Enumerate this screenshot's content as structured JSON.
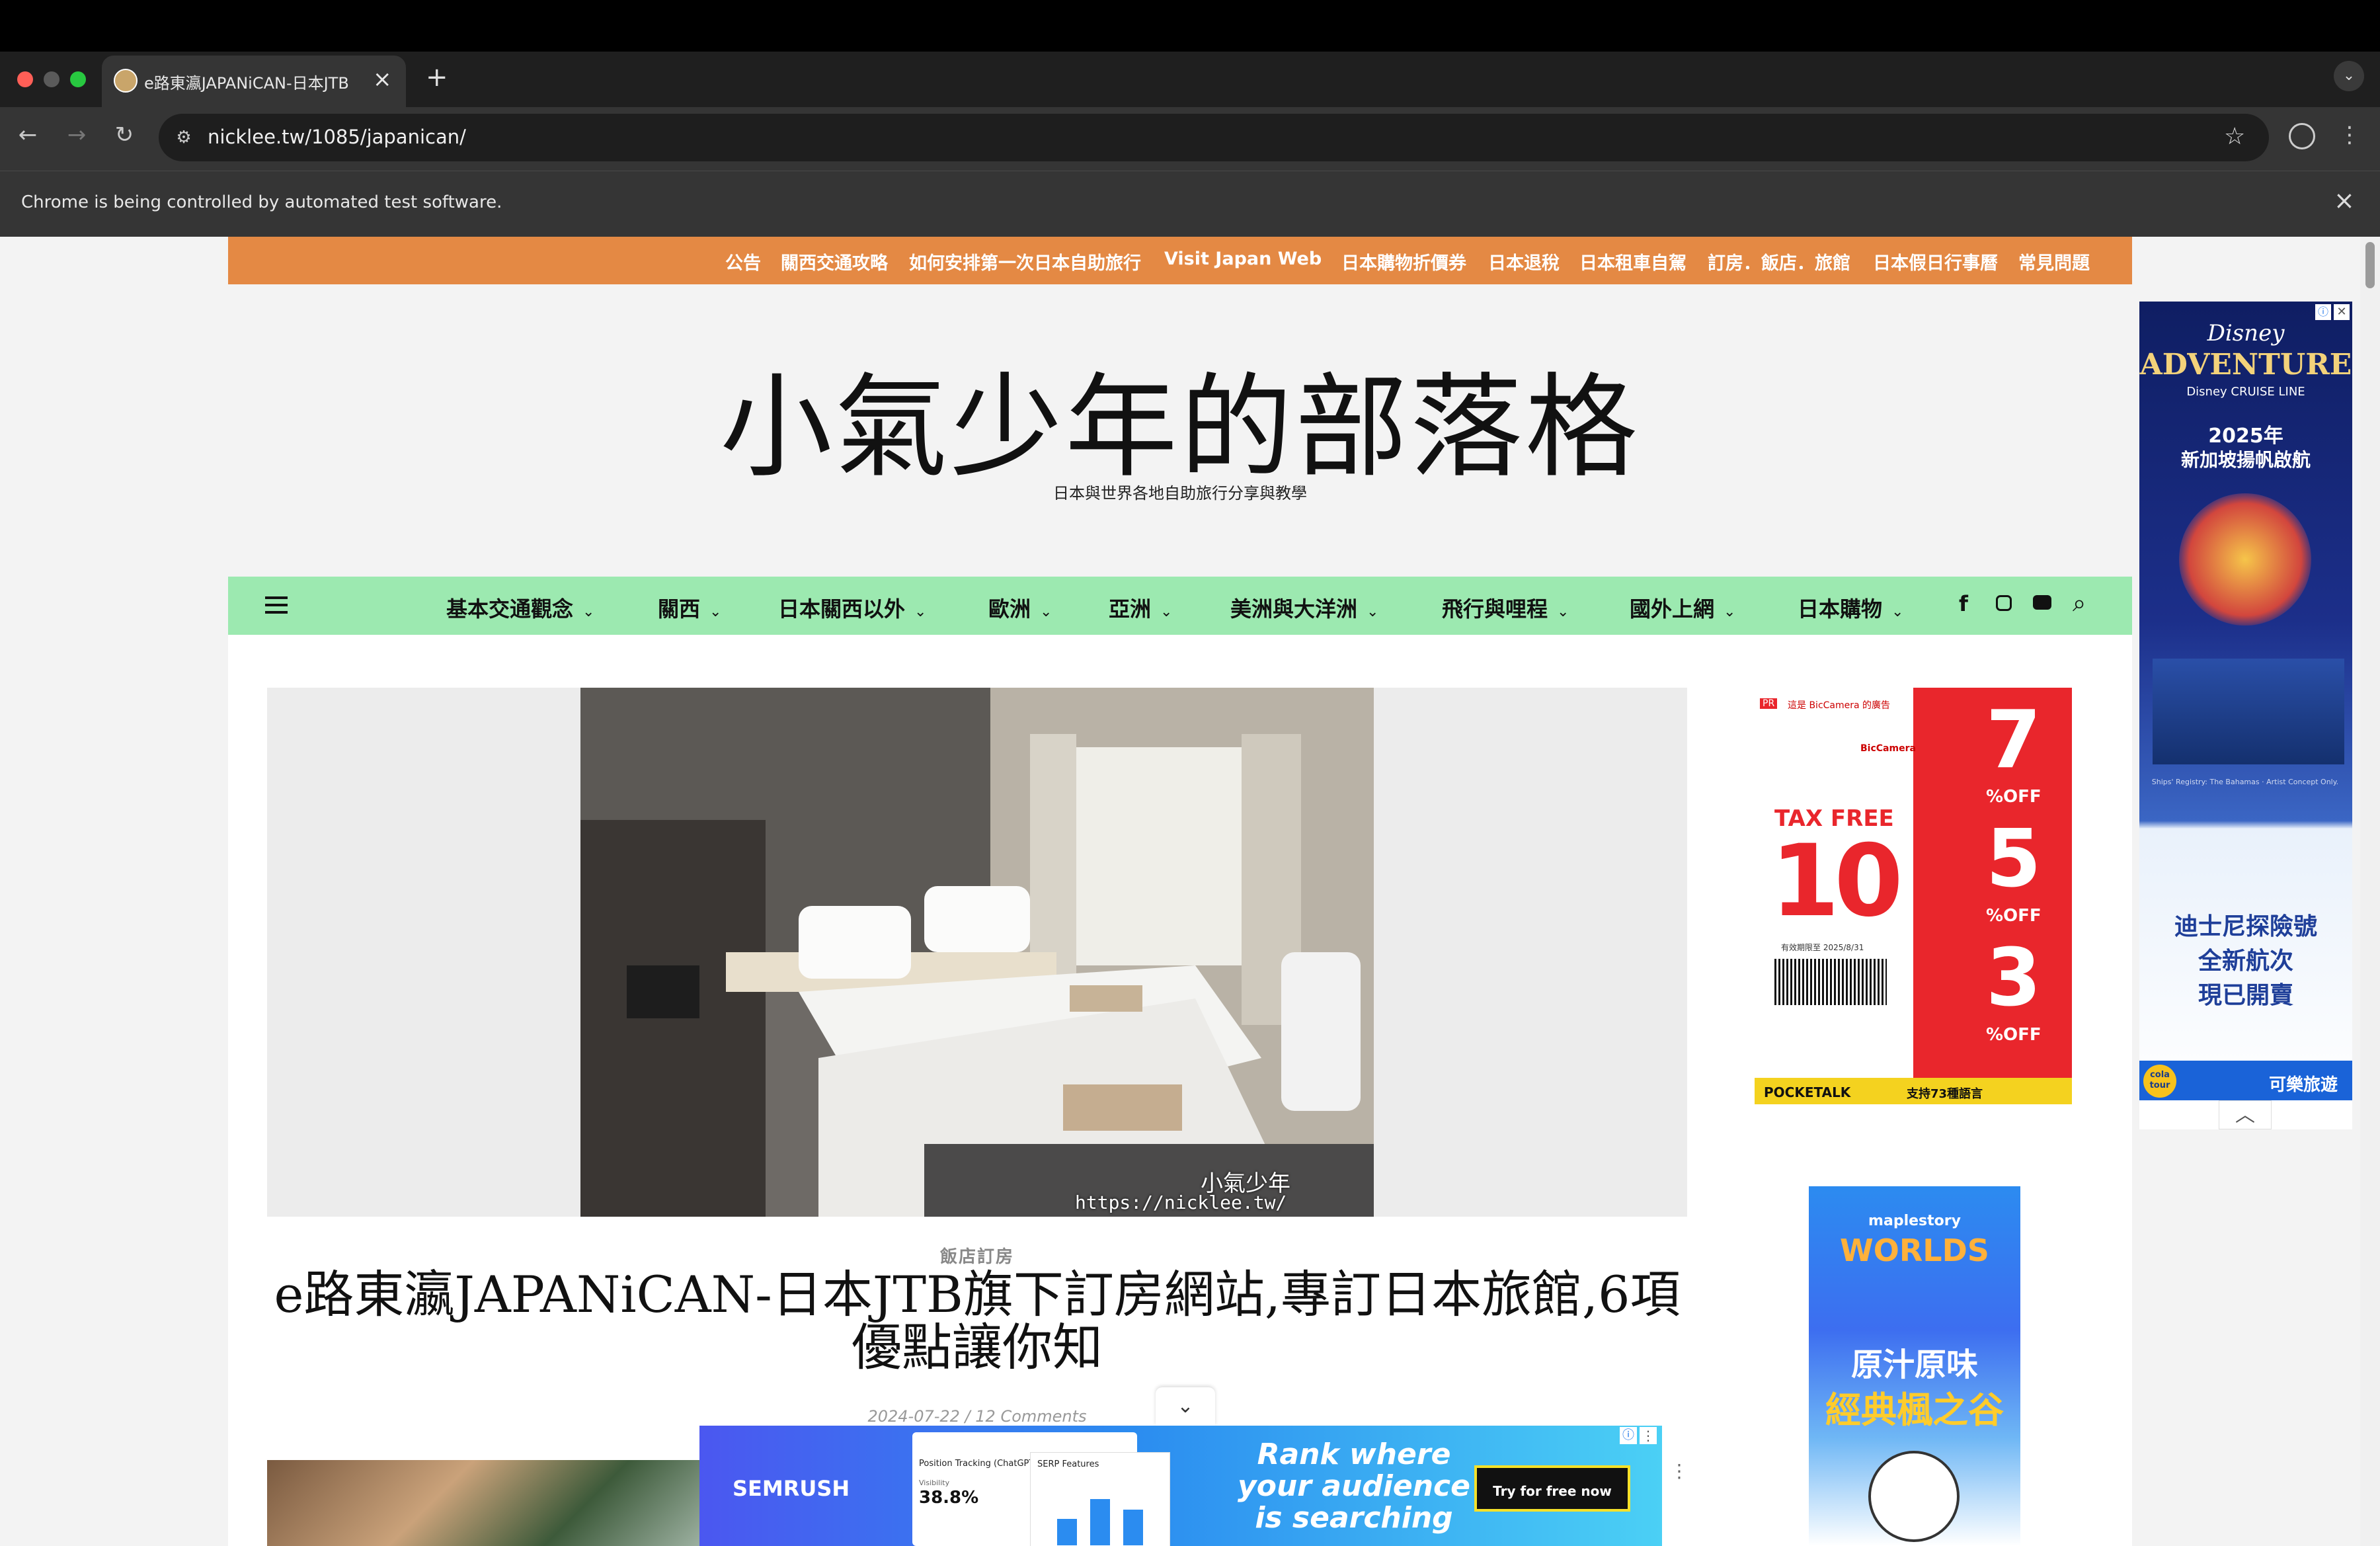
{
  "browser": {
    "tab_title": "e路東瀛JAPANiCAN-日本JTB",
    "tab_close": "×",
    "new_tab": "+",
    "url": "nicklee.tw/1085/japanican/",
    "infobar_text": "Chrome is being controlled by automated test software.",
    "infobar_close": "×"
  },
  "topnav": {
    "items": [
      "公告",
      "關西交通攻略",
      "如何安排第一次日本自助旅行",
      "Visit Japan Web",
      "日本購物折價券",
      "日本退稅",
      "日本租車自駕",
      "訂房．飯店．旅館",
      "日本假日行事曆",
      "常見問題"
    ]
  },
  "site": {
    "title": "小氣少年的部落格",
    "tagline": "日本與世界各地自助旅行分享與教學"
  },
  "mainnav": {
    "items": [
      "基本交通觀念",
      "關西",
      "日本關西以外",
      "歐洲",
      "亞洲",
      "美洲與大洋洲",
      "飛行與哩程",
      "國外上網",
      "日本購物"
    ]
  },
  "post": {
    "category": "飯店訂房",
    "title": "e路東瀛JAPANiCAN-日本JTB旗下訂房網站,專訂日本旅館,6項優點讓你知",
    "meta": "2024-07-22 / 12 Comments",
    "watermark_name": "小氣少年",
    "watermark_url": "https://nicklee.tw/"
  },
  "ads": {
    "disney": {
      "brand": "Disney",
      "headline": "ADVENTURE",
      "subline": "Disney CRUISE LINE",
      "year_line": "2025年",
      "launch_line": "新加坡揚帆啟航",
      "copy": [
        "迪士尼探險號",
        "全新航次",
        "現已開賣"
      ],
      "agency_badge": "cola tour",
      "agency": "可樂旅遊",
      "fine_print": "Ships' Registry: The Bahamas · Artist Concept Only."
    },
    "bic": {
      "pr": "PR",
      "header": "這是 BicCamera 的廣告",
      "brand": "BicCamera",
      "tax_free": "TAX FREE",
      "big_percent": "10",
      "off_top": "7",
      "off_mid": "5",
      "off_bottom": "3",
      "off_label": "%OFF",
      "deadline": "有效期限至 2025/8/31",
      "pocketalk": "POCKETALK",
      "languages": "支持73種語言"
    },
    "maple": {
      "brand": "maplestory",
      "worlds": "WORLDS",
      "line1": "原汁原味",
      "line2": "經典楓之谷"
    },
    "semrush": {
      "brand": "SEMRUSH",
      "card_title": "Position Tracking (ChatGPT)",
      "metric_label": "Visibility",
      "metric_value": "38.8%",
      "card2_title": "SERP Features",
      "headline": [
        "Rank where",
        "your audience",
        "is searching"
      ],
      "cta": "Try for free now"
    }
  },
  "colors": {
    "topnav_bg": "#e48944",
    "mainnav_bg": "#9ce9b0",
    "page_bg": "#f3f3f3"
  }
}
